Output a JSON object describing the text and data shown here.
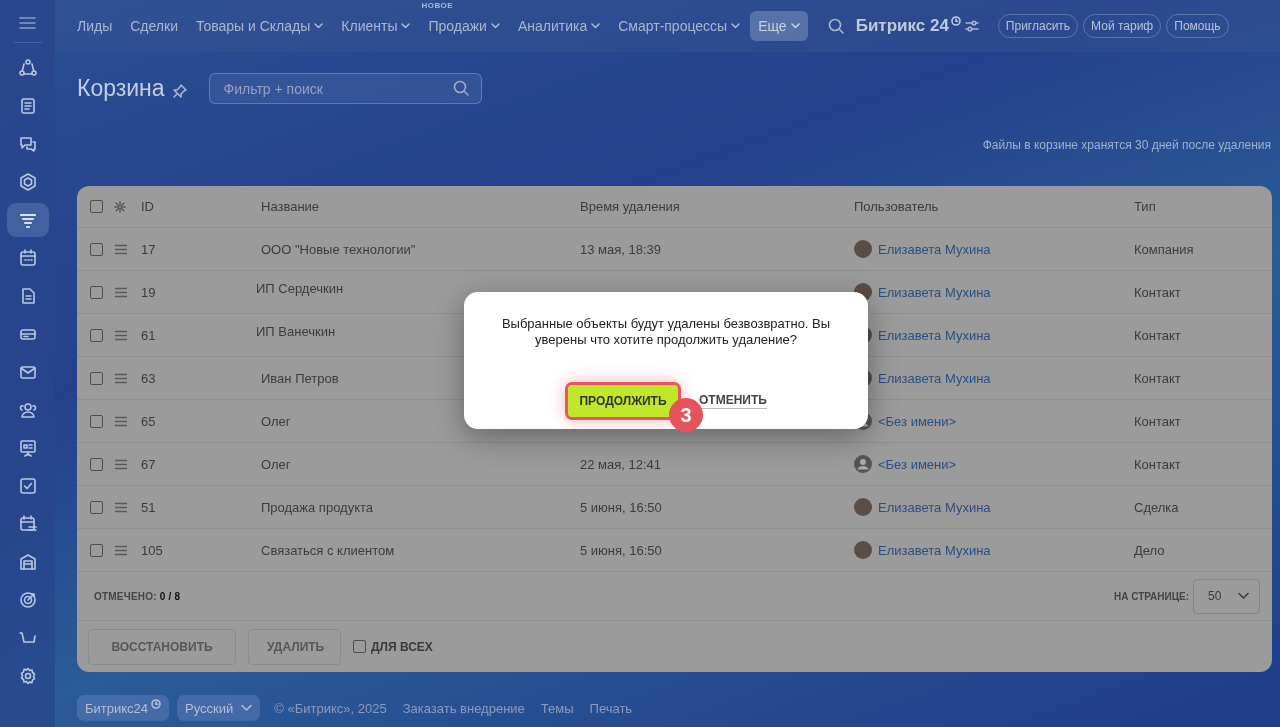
{
  "sidebar": {
    "items": [
      {
        "selected": false
      },
      {
        "selected": false
      },
      {
        "selected": false
      },
      {
        "selected": false
      },
      {
        "selected": true
      },
      {
        "selected": false
      },
      {
        "selected": false
      },
      {
        "selected": false
      },
      {
        "selected": false
      },
      {
        "selected": false
      },
      {
        "selected": false
      },
      {
        "selected": false
      },
      {
        "selected": false
      },
      {
        "selected": false
      },
      {
        "selected": false
      },
      {
        "selected": false
      },
      {
        "selected": false
      }
    ]
  },
  "top_nav": {
    "items": [
      {
        "label": "Лиды",
        "caret": false,
        "selected": false
      },
      {
        "label": "Сделки",
        "caret": false,
        "selected": false
      },
      {
        "label": "Товары и Склады",
        "caret": true,
        "selected": false
      },
      {
        "label": "Клиенты",
        "caret": true,
        "selected": false
      },
      {
        "label": "Продажи",
        "caret": true,
        "selected": false,
        "badge": "НОВОЕ"
      },
      {
        "label": "Аналитика",
        "caret": true,
        "selected": false
      },
      {
        "label": "Смарт-процессы",
        "caret": true,
        "selected": false
      },
      {
        "label": "Еще",
        "caret": true,
        "selected": true
      }
    ],
    "logo": "Битрикс 24",
    "buttons": [
      "Пригласить",
      "Мой тариф",
      "Помощь"
    ]
  },
  "page": {
    "title": "Корзина",
    "search": {
      "placeholder": "Фильтр + поиск"
    },
    "note": "Файлы в корзине хранятся 30 дней после удаления"
  },
  "table": {
    "select_all": {
      "checked": false
    },
    "columns": [
      "ID",
      "Название",
      "Время удаления",
      "Пользователь",
      "Тип"
    ],
    "rows": [
      {
        "checked": false,
        "id": "17",
        "name": "ООО \"Новые технологии\"",
        "time": "13 мая, 18:39",
        "user": "Елизавета Мухина",
        "photo": true,
        "type": "Компания"
      },
      {
        "checked": false,
        "id": "19",
        "name": "ИП Сердечкин",
        "user": "Елизавета Мухина",
        "photo": true,
        "type": "Контакт"
      },
      {
        "checked": false,
        "id": "61",
        "name": "ИП Ванечкин",
        "user": "Елизавета Мухина",
        "photo": true,
        "type": "Контакт"
      },
      {
        "checked": false,
        "id": "63",
        "name": "Иван Петров",
        "user": "Елизавета Мухина",
        "photo": true,
        "type": "Контакт"
      },
      {
        "checked": false,
        "id": "65",
        "name": "Олег",
        "user": "<Без имени>",
        "photo": false,
        "type": "Контакт"
      },
      {
        "checked": false,
        "id": "67",
        "name": "Олег",
        "time": "22 мая, 12:41",
        "user": "<Без имени>",
        "photo": false,
        "type": "Контакт"
      },
      {
        "checked": false,
        "id": "51",
        "name": "Продажа продукта",
        "time": "5 июня, 16:50",
        "user": "Елизавета Мухина",
        "photo": true,
        "type": "Сделка"
      },
      {
        "checked": false,
        "id": "105",
        "name": "Связаться с клиентом",
        "time": "5 июня, 16:50",
        "user": "Елизавета Мухина",
        "photo": true,
        "type": "Дело"
      }
    ],
    "selected_label": "ОТМЕЧЕНО:",
    "selected_count": "0 / 8",
    "per_page_label": "НА СТРАНИЦЕ:",
    "per_page": "50",
    "actions": [
      {
        "label": "ВОССТАНОВИТЬ",
        "disabled": true
      },
      {
        "label": "УДАЛИТЬ",
        "disabled": true
      }
    ],
    "for_all": {
      "label": "ДЛЯ ВСЕХ",
      "checked": false
    }
  },
  "dialog": {
    "message": "Выбранные объекты будут удалены безвозвратно. Вы уверены что хотите продолжить удаление?",
    "confirm": "ПРОДОЛЖИТЬ",
    "cancel": "ОТМЕНИТЬ",
    "step": "3"
  },
  "footer": {
    "brand": "Битрикс24",
    "language": "Русский",
    "copyright": "© «Битрикс», 2025",
    "links": [
      "Заказать внедрение",
      "Темы",
      "Печать"
    ]
  }
}
